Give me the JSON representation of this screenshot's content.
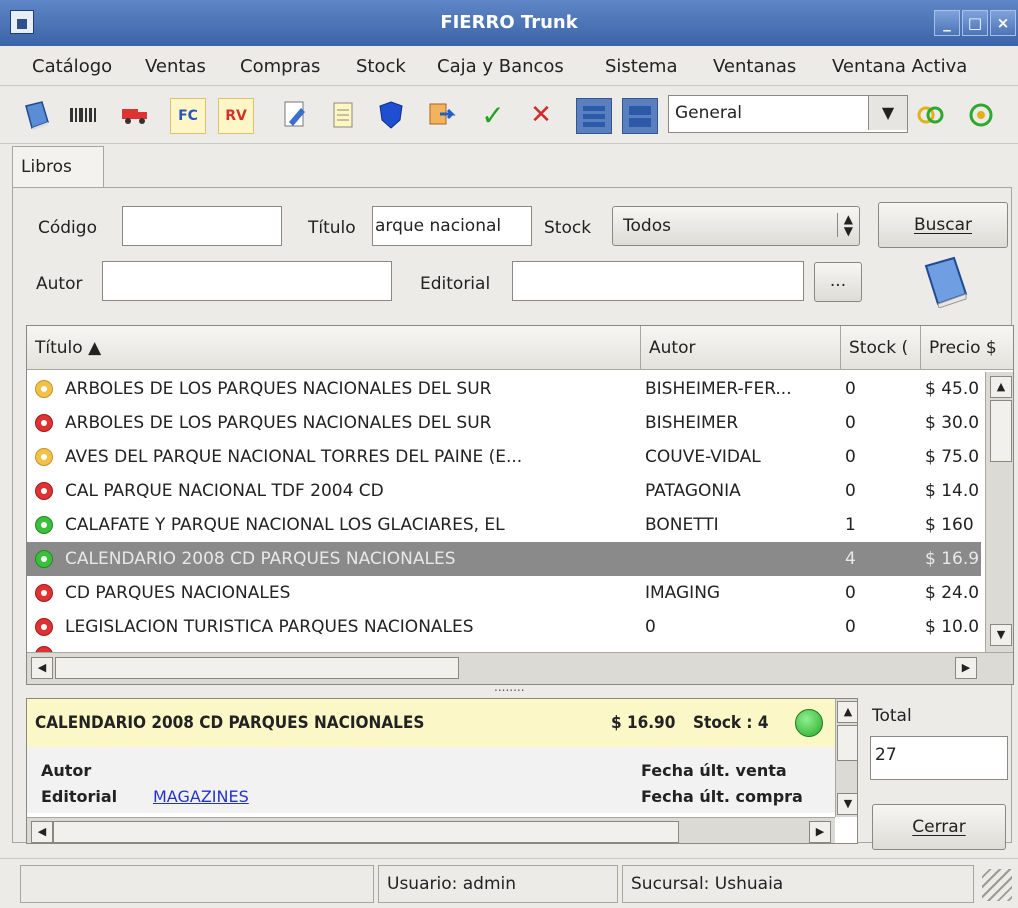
{
  "window": {
    "title": "FIERRO Trunk"
  },
  "menu": [
    "Catálogo",
    "Ventas",
    "Compras",
    "Stock",
    "Caja y Bancos",
    "Sistema",
    "Ventanas",
    "Ventana Activa"
  ],
  "toolbar": {
    "fc_label": "FC",
    "rv_label": "RV",
    "combo_value": "General"
  },
  "tab": {
    "label": "Libros"
  },
  "search": {
    "codigo_label": "Código",
    "codigo_value": "",
    "titulo_label": "Título",
    "titulo_value": "arque nacional",
    "stock_label": "Stock",
    "stock_value": "Todos",
    "buscar_label": "Buscar",
    "autor_label": "Autor",
    "autor_value": "",
    "editorial_label": "Editorial",
    "editorial_value": "",
    "browse_label": "..."
  },
  "table": {
    "headers": [
      "Título ▲",
      "Autor",
      "Stock (",
      "Precio $"
    ],
    "rows": [
      {
        "status": "yellow",
        "titulo": "ARBOLES DE LOS PARQUES NACIONALES DEL SUR",
        "autor": "BISHEIMER-FER...",
        "stock": "0",
        "precio": "$ 45.0"
      },
      {
        "status": "red",
        "titulo": "ARBOLES DE LOS PARQUES NACIONALES DEL SUR",
        "autor": "BISHEIMER",
        "stock": "0",
        "precio": "$ 30.0"
      },
      {
        "status": "yellow",
        "titulo": "AVES DEL PARQUE NACIONAL TORRES DEL PAINE (E...",
        "autor": "COUVE-VIDAL",
        "stock": "0",
        "precio": "$ 75.0"
      },
      {
        "status": "red",
        "titulo": "CAL PARQUE NACIONAL TDF 2004 CD",
        "autor": "PATAGONIA",
        "stock": "0",
        "precio": "$ 14.0"
      },
      {
        "status": "green",
        "titulo": "CALAFATE Y PARQUE NACIONAL LOS GLACIARES, EL",
        "autor": "BONETTI",
        "stock": "1",
        "precio": "$ 160"
      },
      {
        "status": "green",
        "titulo": "CALENDARIO 2008 CD PARQUES NACIONALES",
        "autor": "",
        "stock": "4",
        "precio": "$ 16.9",
        "selected": true
      },
      {
        "status": "red",
        "titulo": "CD PARQUES NACIONALES",
        "autor": "IMAGING",
        "stock": "0",
        "precio": "$ 24.0"
      },
      {
        "status": "red",
        "titulo": "LEGISLACION TURISTICA PARQUES NACIONALES",
        "autor": "0",
        "stock": "0",
        "precio": "$ 10.0"
      }
    ]
  },
  "splitter": {
    "grip": "........"
  },
  "detail": {
    "title": "CALENDARIO 2008 CD PARQUES NACIONALES",
    "price": "$ 16.90",
    "stock": "Stock : 4",
    "autor_label": "Autor",
    "editorial_label": "Editorial",
    "editorial_value": "MAGAZINES",
    "fecha_venta_label": "Fecha últ. venta",
    "fecha_compra_label": "Fecha últ. compra"
  },
  "total": {
    "label": "Total",
    "value": "27"
  },
  "cerrar_label": "Cerrar",
  "statusbar": {
    "usuario": "Usuario: admin",
    "sucursal": "Sucursal: Ushuaia"
  },
  "colors": {
    "title_bar": "#3b64a8",
    "selected_row": "#8a8a8a",
    "detail_header": "#fbf7c6",
    "link": "#2233cc"
  }
}
